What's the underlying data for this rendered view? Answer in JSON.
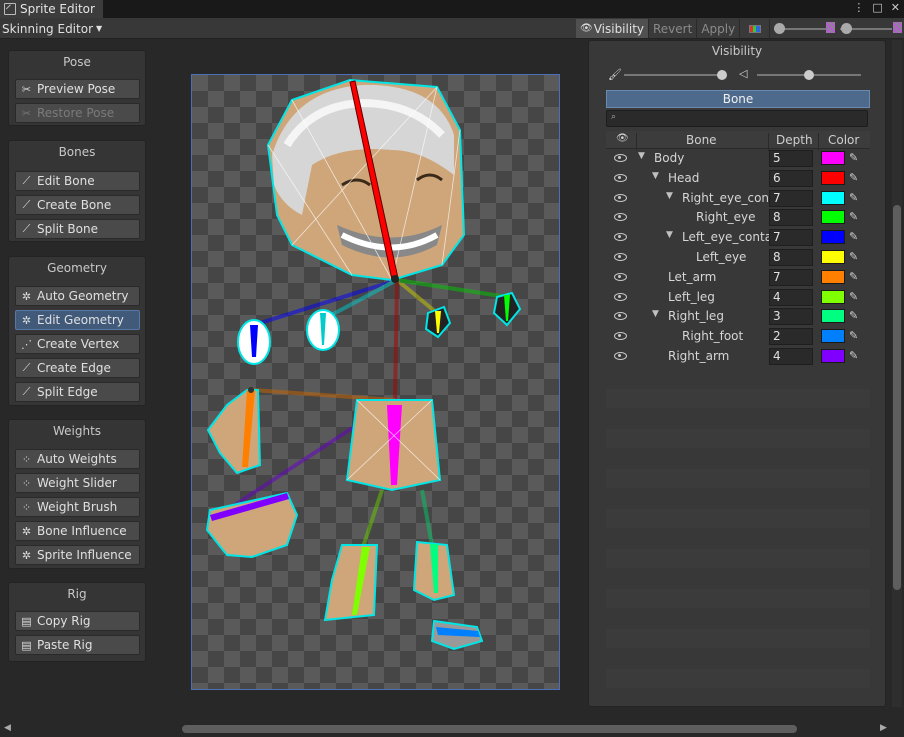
{
  "window": {
    "title": "Sprite Editor",
    "menu_icon": "kebab-icon",
    "maximize_icon": "maximize-icon",
    "close_icon": "close-icon"
  },
  "toolbar": {
    "mode": "Skinning Editor",
    "visibility": "Visibility",
    "revert": "Revert",
    "apply": "Apply"
  },
  "panels": {
    "pose": {
      "title": "Pose",
      "items": [
        {
          "label": "Preview Pose",
          "icon": "preview-pose-icon"
        },
        {
          "label": "Restore Pose",
          "icon": "restore-pose-icon"
        }
      ]
    },
    "bones": {
      "title": "Bones",
      "items": [
        {
          "label": "Edit Bone",
          "icon": "edit-bone-icon"
        },
        {
          "label": "Create Bone",
          "icon": "create-bone-icon"
        },
        {
          "label": "Split Bone",
          "icon": "split-bone-icon"
        }
      ]
    },
    "geometry": {
      "title": "Geometry",
      "items": [
        {
          "label": "Auto Geometry",
          "icon": "auto-geometry-icon"
        },
        {
          "label": "Edit Geometry",
          "icon": "edit-geometry-icon"
        },
        {
          "label": "Create Vertex",
          "icon": "create-vertex-icon"
        },
        {
          "label": "Create Edge",
          "icon": "create-edge-icon"
        },
        {
          "label": "Split Edge",
          "icon": "split-edge-icon"
        }
      ]
    },
    "weights": {
      "title": "Weights",
      "items": [
        {
          "label": "Auto Weights",
          "icon": "auto-weights-icon"
        },
        {
          "label": "Weight Slider",
          "icon": "weight-slider-icon"
        },
        {
          "label": "Weight Brush",
          "icon": "weight-brush-icon"
        },
        {
          "label": "Bone Influence",
          "icon": "bone-influence-icon"
        },
        {
          "label": "Sprite Influence",
          "icon": "sprite-influence-icon"
        }
      ]
    },
    "rig": {
      "title": "Rig",
      "items": [
        {
          "label": "Copy Rig",
          "icon": "copy-icon"
        },
        {
          "label": "Paste Rig",
          "icon": "paste-icon"
        }
      ]
    }
  },
  "visibility": {
    "title": "Visibility",
    "tab": "Bone",
    "columns": {
      "bone": "Bone",
      "depth": "Depth",
      "color": "Color"
    },
    "bones": [
      {
        "name": "Body",
        "depth": "5",
        "color": "#ff00ff",
        "expanded": true
      },
      {
        "name": "Head",
        "depth": "6",
        "color": "#ff0000",
        "expanded": true
      },
      {
        "name": "Right_eye_cont",
        "depth": "7",
        "color": "#00ffff",
        "expanded": true
      },
      {
        "name": "Right_eye",
        "depth": "8",
        "color": "#00ff00",
        "expanded": false
      },
      {
        "name": "Left_eye_conta",
        "depth": "7",
        "color": "#0000ff",
        "expanded": true
      },
      {
        "name": "Left_eye",
        "depth": "8",
        "color": "#ffff00",
        "expanded": false
      },
      {
        "name": "Let_arm",
        "depth": "7",
        "color": "#ff8000",
        "expanded": false
      },
      {
        "name": "Left_leg",
        "depth": "4",
        "color": "#80ff00",
        "expanded": false
      },
      {
        "name": "Right_leg",
        "depth": "3",
        "color": "#00ff80",
        "expanded": true
      },
      {
        "name": "Right_foot",
        "depth": "2",
        "color": "#0080ff",
        "expanded": false
      },
      {
        "name": "Right_arm",
        "depth": "4",
        "color": "#8000ff",
        "expanded": false
      }
    ]
  }
}
